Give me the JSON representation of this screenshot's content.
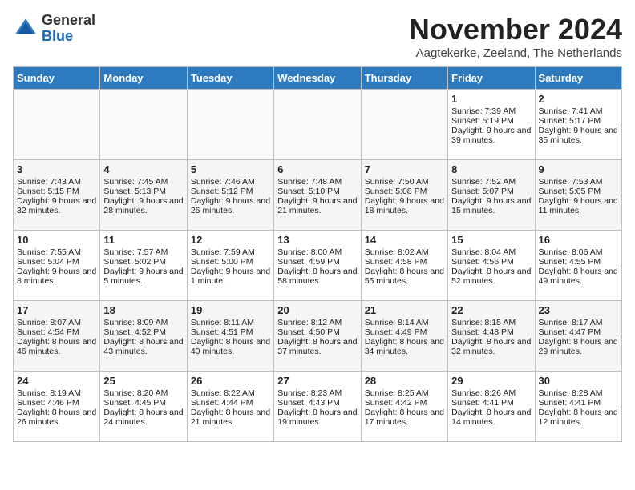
{
  "header": {
    "logo_general": "General",
    "logo_blue": "Blue",
    "title": "November 2024",
    "location": "Aagtekerke, Zeeland, The Netherlands"
  },
  "days_of_week": [
    "Sunday",
    "Monday",
    "Tuesday",
    "Wednesday",
    "Thursday",
    "Friday",
    "Saturday"
  ],
  "weeks": [
    [
      {
        "day": "",
        "info": ""
      },
      {
        "day": "",
        "info": ""
      },
      {
        "day": "",
        "info": ""
      },
      {
        "day": "",
        "info": ""
      },
      {
        "day": "",
        "info": ""
      },
      {
        "day": "1",
        "info": "Sunrise: 7:39 AM\nSunset: 5:19 PM\nDaylight: 9 hours and 39 minutes."
      },
      {
        "day": "2",
        "info": "Sunrise: 7:41 AM\nSunset: 5:17 PM\nDaylight: 9 hours and 35 minutes."
      }
    ],
    [
      {
        "day": "3",
        "info": "Sunrise: 7:43 AM\nSunset: 5:15 PM\nDaylight: 9 hours and 32 minutes."
      },
      {
        "day": "4",
        "info": "Sunrise: 7:45 AM\nSunset: 5:13 PM\nDaylight: 9 hours and 28 minutes."
      },
      {
        "day": "5",
        "info": "Sunrise: 7:46 AM\nSunset: 5:12 PM\nDaylight: 9 hours and 25 minutes."
      },
      {
        "day": "6",
        "info": "Sunrise: 7:48 AM\nSunset: 5:10 PM\nDaylight: 9 hours and 21 minutes."
      },
      {
        "day": "7",
        "info": "Sunrise: 7:50 AM\nSunset: 5:08 PM\nDaylight: 9 hours and 18 minutes."
      },
      {
        "day": "8",
        "info": "Sunrise: 7:52 AM\nSunset: 5:07 PM\nDaylight: 9 hours and 15 minutes."
      },
      {
        "day": "9",
        "info": "Sunrise: 7:53 AM\nSunset: 5:05 PM\nDaylight: 9 hours and 11 minutes."
      }
    ],
    [
      {
        "day": "10",
        "info": "Sunrise: 7:55 AM\nSunset: 5:04 PM\nDaylight: 9 hours and 8 minutes."
      },
      {
        "day": "11",
        "info": "Sunrise: 7:57 AM\nSunset: 5:02 PM\nDaylight: 9 hours and 5 minutes."
      },
      {
        "day": "12",
        "info": "Sunrise: 7:59 AM\nSunset: 5:00 PM\nDaylight: 9 hours and 1 minute."
      },
      {
        "day": "13",
        "info": "Sunrise: 8:00 AM\nSunset: 4:59 PM\nDaylight: 8 hours and 58 minutes."
      },
      {
        "day": "14",
        "info": "Sunrise: 8:02 AM\nSunset: 4:58 PM\nDaylight: 8 hours and 55 minutes."
      },
      {
        "day": "15",
        "info": "Sunrise: 8:04 AM\nSunset: 4:56 PM\nDaylight: 8 hours and 52 minutes."
      },
      {
        "day": "16",
        "info": "Sunrise: 8:06 AM\nSunset: 4:55 PM\nDaylight: 8 hours and 49 minutes."
      }
    ],
    [
      {
        "day": "17",
        "info": "Sunrise: 8:07 AM\nSunset: 4:54 PM\nDaylight: 8 hours and 46 minutes."
      },
      {
        "day": "18",
        "info": "Sunrise: 8:09 AM\nSunset: 4:52 PM\nDaylight: 8 hours and 43 minutes."
      },
      {
        "day": "19",
        "info": "Sunrise: 8:11 AM\nSunset: 4:51 PM\nDaylight: 8 hours and 40 minutes."
      },
      {
        "day": "20",
        "info": "Sunrise: 8:12 AM\nSunset: 4:50 PM\nDaylight: 8 hours and 37 minutes."
      },
      {
        "day": "21",
        "info": "Sunrise: 8:14 AM\nSunset: 4:49 PM\nDaylight: 8 hours and 34 minutes."
      },
      {
        "day": "22",
        "info": "Sunrise: 8:15 AM\nSunset: 4:48 PM\nDaylight: 8 hours and 32 minutes."
      },
      {
        "day": "23",
        "info": "Sunrise: 8:17 AM\nSunset: 4:47 PM\nDaylight: 8 hours and 29 minutes."
      }
    ],
    [
      {
        "day": "24",
        "info": "Sunrise: 8:19 AM\nSunset: 4:46 PM\nDaylight: 8 hours and 26 minutes."
      },
      {
        "day": "25",
        "info": "Sunrise: 8:20 AM\nSunset: 4:45 PM\nDaylight: 8 hours and 24 minutes."
      },
      {
        "day": "26",
        "info": "Sunrise: 8:22 AM\nSunset: 4:44 PM\nDaylight: 8 hours and 21 minutes."
      },
      {
        "day": "27",
        "info": "Sunrise: 8:23 AM\nSunset: 4:43 PM\nDaylight: 8 hours and 19 minutes."
      },
      {
        "day": "28",
        "info": "Sunrise: 8:25 AM\nSunset: 4:42 PM\nDaylight: 8 hours and 17 minutes."
      },
      {
        "day": "29",
        "info": "Sunrise: 8:26 AM\nSunset: 4:41 PM\nDaylight: 8 hours and 14 minutes."
      },
      {
        "day": "30",
        "info": "Sunrise: 8:28 AM\nSunset: 4:41 PM\nDaylight: 8 hours and 12 minutes."
      }
    ]
  ]
}
